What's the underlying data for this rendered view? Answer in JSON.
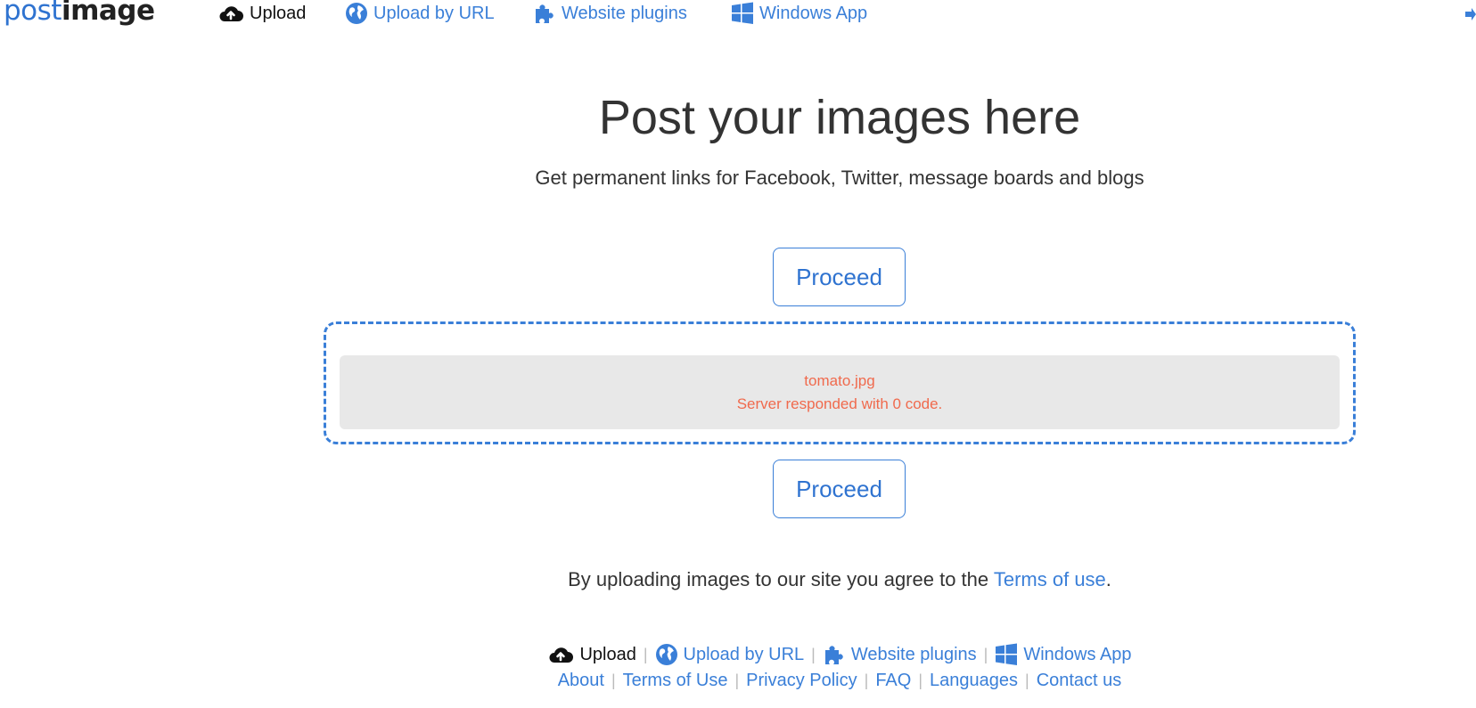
{
  "nav": {
    "logo_post": "post",
    "logo_image": "image",
    "upload": "Upload",
    "upload_by_url": "Upload by URL",
    "website_plugins": "Website plugins",
    "windows_app": "Windows App"
  },
  "hero": {
    "title": "Post your images here",
    "subtitle": "Get permanent links for Facebook, Twitter, message boards and blogs"
  },
  "actions": {
    "proceed_top": "Proceed",
    "proceed_bottom": "Proceed"
  },
  "dropzone": {
    "file_name": "tomato.jpg",
    "error": "Server responded with 0 code."
  },
  "agreement": {
    "text": "By uploading images to our site you agree to the ",
    "link": "Terms of use",
    "suffix": "."
  },
  "footer": {
    "upload": "Upload",
    "upload_by_url": "Upload by URL",
    "website_plugins": "Website plugins",
    "windows_app": "Windows App",
    "about": "About",
    "terms": "Terms of Use",
    "privacy": "Privacy Policy",
    "faq": "FAQ",
    "languages": "Languages",
    "contact": "Contact us",
    "separator": "|"
  },
  "colors": {
    "accent": "#3a7fd8",
    "error": "#f06a4d",
    "text": "#333333",
    "file_bg": "#e8e8e8"
  },
  "icons": {
    "upload": "cloud-upload-icon",
    "url": "globe-icon",
    "plugins": "puzzle-icon",
    "windows": "windows-icon",
    "edge": "sign-in-icon"
  }
}
